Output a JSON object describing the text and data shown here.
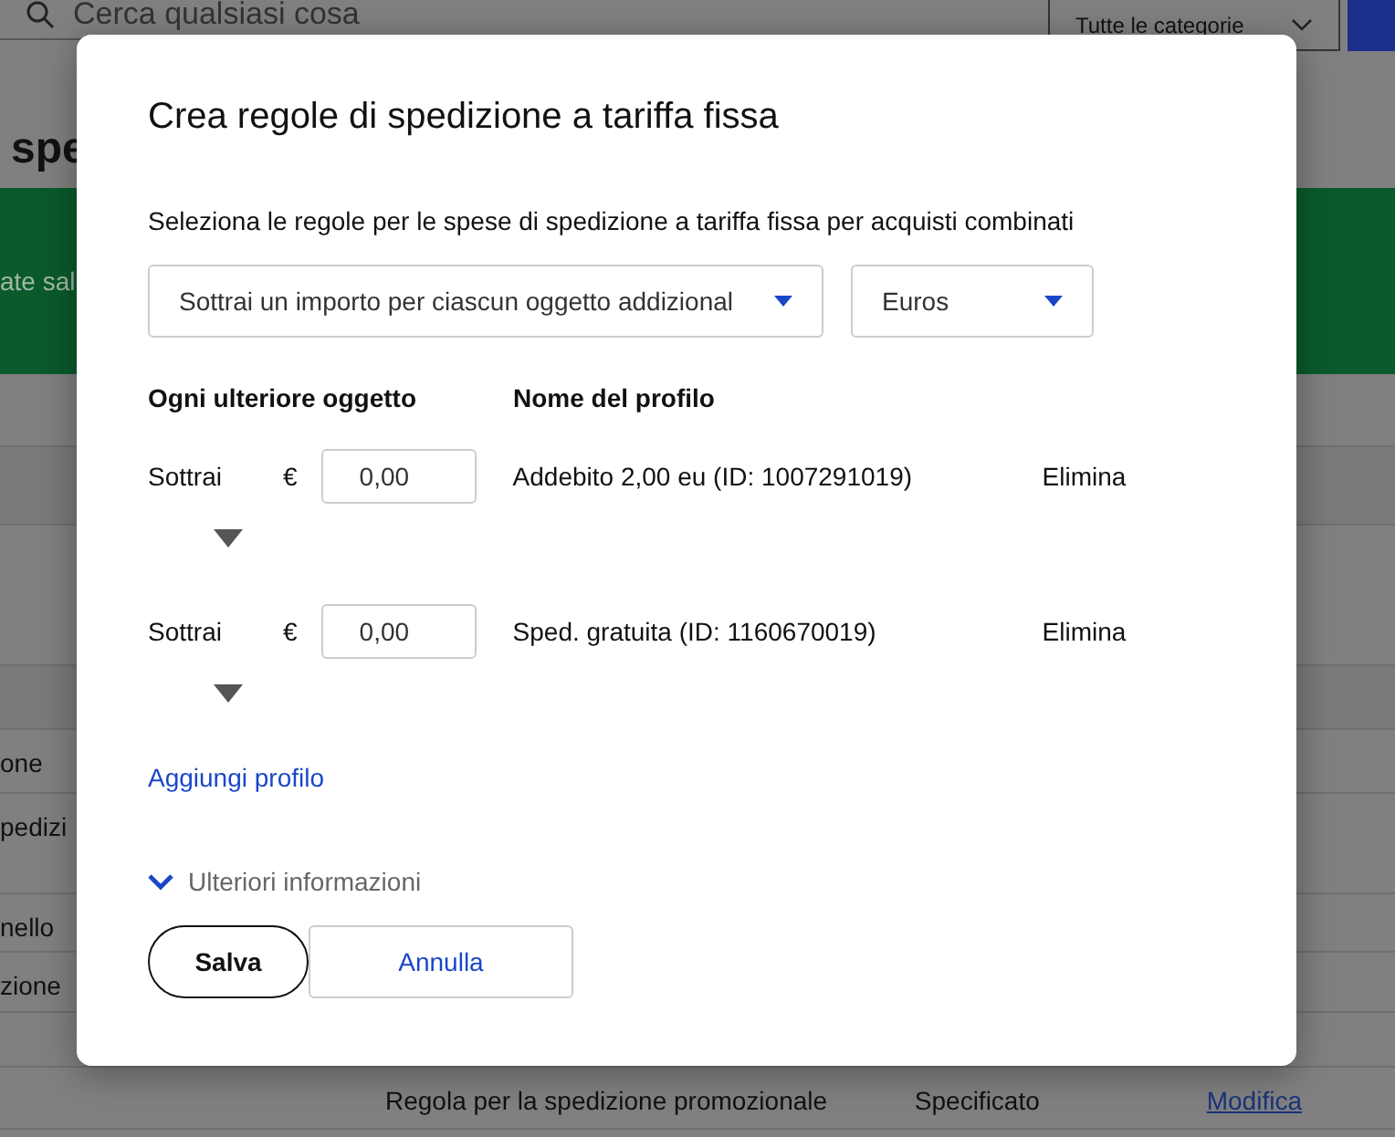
{
  "background": {
    "search": {
      "placeholder": "Cerca qualsiasi cosa"
    },
    "category": "Tutte le categorie",
    "heading": "spe",
    "banner": "ate sal",
    "rows": [
      {
        "left": "one"
      },
      {
        "left": "pedizi"
      },
      {
        "left": "nello"
      },
      {
        "left": "zione"
      }
    ],
    "last_row": {
      "rule": "Regola per la spedizione promozionale",
      "status": "Specificato",
      "link": "Modifica"
    }
  },
  "dialog": {
    "title": "Crea regole di spedizione a tariffa fissa",
    "intro": "Seleziona le regole per le spese di spedizione a tariffa fissa per acquisti combinati",
    "rule_type": "Sottrai un importo per ciascun oggetto addizional",
    "currency": "Euros",
    "columns": [
      "Ogni ulteriore oggetto",
      "Nome del profilo"
    ],
    "rules": [
      {
        "operation": "Sottrai",
        "currency_symbol": "€",
        "amount": "0,00",
        "profile": "Addebito 2,00 eu (ID: 1007291019)",
        "action": "Elimina"
      },
      {
        "operation": "Sottrai",
        "currency_symbol": "€",
        "amount": "0,00",
        "profile": "Sped. gratuita (ID: 1160670019)",
        "action": "Elimina"
      }
    ],
    "add_link": "Aggiungi profilo",
    "more_info": {
      "label": "Ulteriori informazioni",
      "expanded": false
    },
    "save": "Salva",
    "cancel": "Annulla"
  }
}
